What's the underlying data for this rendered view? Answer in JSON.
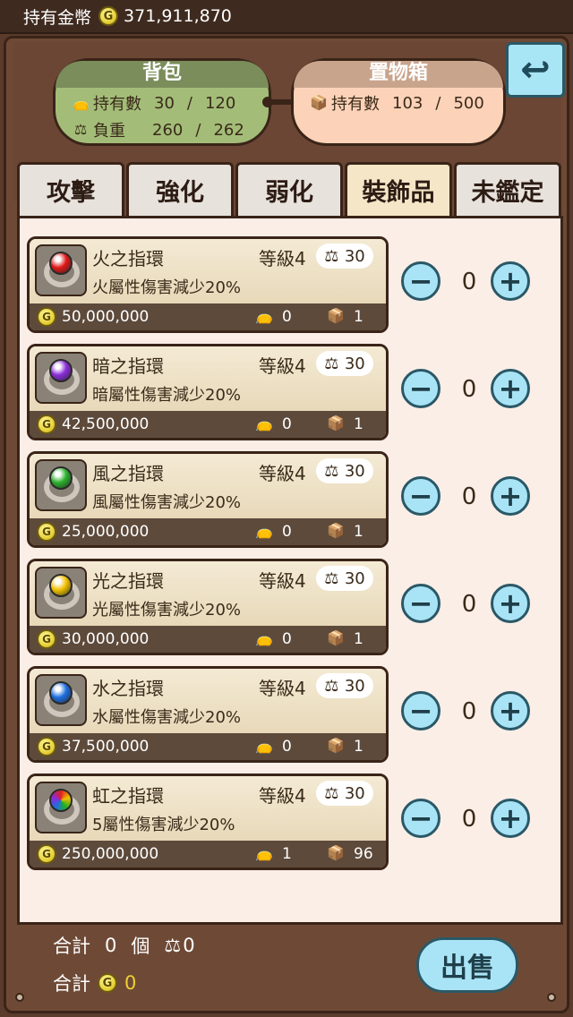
{
  "topbar": {
    "label": "持有金幣",
    "coin": "G",
    "gold": "371,911,870"
  },
  "bag": {
    "title": "背包",
    "count_label": "持有數",
    "count": "30",
    "count_max": "120",
    "weight_label": "負重",
    "weight": "260",
    "weight_max": "262",
    "sep": "/"
  },
  "box": {
    "title": "置物箱",
    "count_label": "持有數",
    "count": "103",
    "count_max": "500",
    "sep": "/"
  },
  "back_icon": "undo-arrow-icon",
  "tabs": [
    {
      "label": "攻擊"
    },
    {
      "label": "強化"
    },
    {
      "label": "弱化"
    },
    {
      "label": "裝飾品",
      "active": true
    },
    {
      "label": "未鑑定"
    }
  ],
  "items": [
    {
      "name": "火之指環",
      "level": "等級4",
      "weight": "30",
      "desc": "火屬性傷害減少20%",
      "price": "50,000,000",
      "bag": "0",
      "box": "1",
      "qty": "0",
      "gem_color": "#e01818"
    },
    {
      "name": "暗之指環",
      "level": "等級4",
      "weight": "30",
      "desc": "暗屬性傷害減少20%",
      "price": "42,500,000",
      "bag": "0",
      "box": "1",
      "qty": "0",
      "gem_color": "#8a2cd8"
    },
    {
      "name": "風之指環",
      "level": "等級4",
      "weight": "30",
      "desc": "風屬性傷害減少20%",
      "price": "25,000,000",
      "bag": "0",
      "box": "1",
      "qty": "0",
      "gem_color": "#2cb02c"
    },
    {
      "name": "光之指環",
      "level": "等級4",
      "weight": "30",
      "desc": "光屬性傷害減少20%",
      "price": "30,000,000",
      "bag": "0",
      "box": "1",
      "qty": "0",
      "gem_color": "#f0c000"
    },
    {
      "name": "水之指環",
      "level": "等級4",
      "weight": "30",
      "desc": "水屬性傷害減少20%",
      "price": "37,500,000",
      "bag": "0",
      "box": "1",
      "qty": "0",
      "gem_color": "#1e6ee0"
    },
    {
      "name": "虹之指環",
      "level": "等級4",
      "weight": "30",
      "desc": "5屬性傷害減少20%",
      "price": "250,000,000",
      "bag": "1",
      "box": "96",
      "qty": "0",
      "gem_color": "rainbow"
    }
  ],
  "stepper": {
    "minus": "−",
    "plus": "+"
  },
  "footer": {
    "total_label": "合計",
    "count": "0",
    "unit": "個",
    "weight": "0",
    "total_label2": "合計",
    "gold": "0",
    "sell": "出售"
  }
}
